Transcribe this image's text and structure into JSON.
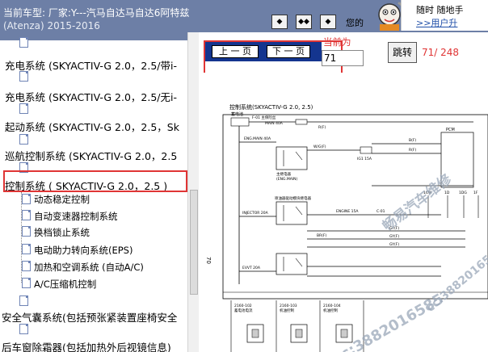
{
  "vehicle": {
    "line1": "当前车型:   厂家:Y---汽马自达马自达6阿特兹",
    "line2": "(Atenza) 2015-2016"
  },
  "toolbar": {
    "promo_prefix": "您的",
    "banner_line1": "随时 随地手",
    "banner_line2": ">>用户升"
  },
  "nav": {
    "prev_label": "上 一 页",
    "next_label": "下 一 页",
    "current_label": "当前为",
    "page_value": "71",
    "jump_label": "跳转",
    "page_count": "71/ 248"
  },
  "tree": {
    "items": [
      {
        "label": "充电系统 (SKYACTIV-G 2.0，2.5/带i-"
      },
      {
        "label": "充电系统 (SKYACTIV-G 2.0，2.5/无i-"
      },
      {
        "label": "起动系统 (SKYACTIV-G 2.0，2.5，Sk"
      },
      {
        "label": "巡航控制系统 (SKYACTIV-G 2.0，2.5"
      },
      {
        "label": "控制系统 ( SKYACTIV-G 2.0，2.5 )"
      },
      {
        "label": "安全气囊系统(包括预张紧装置座椅安全"
      },
      {
        "label": "后车窗除霜器(包括加热外后视镜信息)"
      }
    ],
    "children": [
      {
        "label": "动态稳定控制"
      },
      {
        "label": "自动变速器控制系统"
      },
      {
        "label": "换档锁止系统"
      },
      {
        "label": "电动助力转向系统(EPS)"
      },
      {
        "label": "加热和空调系统 (自动A/C)"
      },
      {
        "label": "A/C压缩机控制"
      }
    ]
  },
  "diagram": {
    "title": "控制系统(SKYACTIV-G 2.0, 2.5)",
    "side_number": "70",
    "labels": {
      "battery": "蓄电池",
      "main_fuse": "F-01 主保险丝",
      "main_40a": "MAIN 40A",
      "eng_main": "ENG.MAIN 40A",
      "relay": "主继电器",
      "relay_en": "(ENG.MAIN)",
      "inj_relay": "喷油器驱动模块继电器",
      "injector": "INJECTOR 20A",
      "evvt": "EVVT 20A",
      "pcm": "PCM",
      "c01": "C-01",
      "engine": "ENGINE 15A",
      "ig_key": "IG1 15A",
      "w_color": "W/G(F)",
      "r_color": "R(F)",
      "br_color": "BR(F)",
      "gy_color": "GY(F)",
      "b_color": "B(F)",
      "conn1": "2160-102",
      "conn1b": "蓄电池电流",
      "conn2": "2160-103",
      "conn2b": "机油控制",
      "conn3": "2160-104",
      "conn3b": "机油控制",
      "wire_1cw": "1CW",
      "wire_1d": "1D",
      "wire_1dg": "1DG",
      "wire_1f": "1F"
    },
    "watermarks": {
      "wm1": "畅易汽车维修",
      "wm2": "cc:3882016585",
      "wm3": "cc:3882016585"
    }
  },
  "colors": {
    "toolbar_bg": "#6d7fa6",
    "pager_blue": "#14358f",
    "highlight_red": "#e03535"
  },
  "icons": [
    "document-icon",
    "skip-prev-icon",
    "skip-both-icon",
    "skip-next-icon"
  ]
}
